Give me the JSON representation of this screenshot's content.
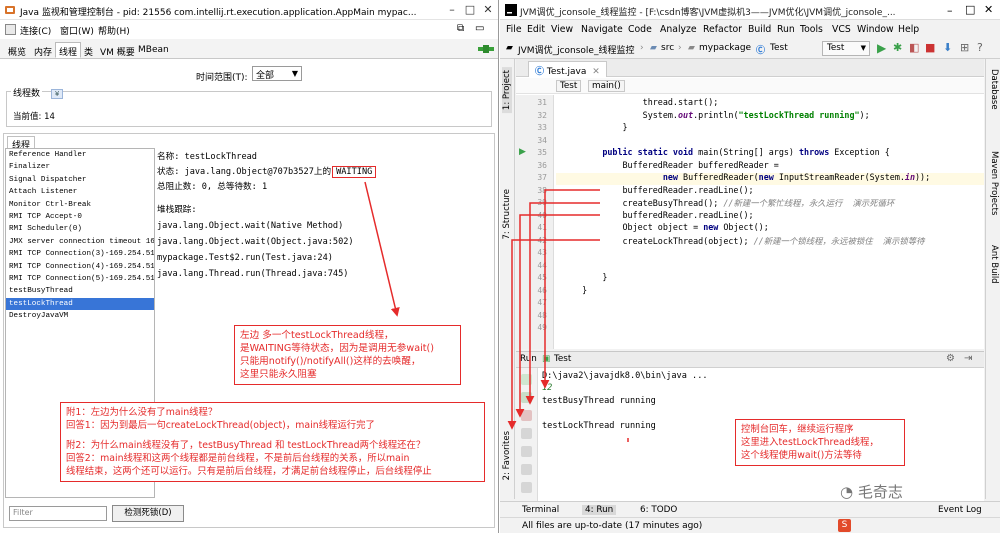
{
  "jconsole": {
    "title": "Java 监视和管理控制台 - pid: 21556 com.intellij.rt.execution.application.AppMain mypac...",
    "menu": [
      "连接(C)",
      "窗口(W)",
      "帮助(H)"
    ],
    "tabs": [
      "概览",
      "内存",
      "线程",
      "类",
      "VM 概要",
      "MBean"
    ],
    "time_range_label": "时间范围(T):",
    "time_range_value": "全部",
    "thread_count_title": "线程数",
    "current_value": "当前值:  14",
    "threads_title": "线程",
    "thread_list": [
      "Reference Handler",
      "Finalizer",
      "Signal Dispatcher",
      "Attach Listener",
      "Monitor Ctrl-Break",
      "RMI TCP Accept-0",
      "RMI Scheduler(0)",
      "JMX server connection timeout 16",
      "RMI TCP Connection(3)-169.254.51.",
      "RMI TCP Connection(4)-169.254.51.",
      "RMI TCP Connection(5)-169.254.51.",
      "testBusyThread",
      "testLockThread",
      "DestroyJavaVM"
    ],
    "selected_thread_index": 12,
    "detail": {
      "name": "名称:  testLockThread",
      "state_prefix": "状态:  java.lang.Object@707b3527上的",
      "state_value": "WAITING",
      "blocked": "总阻止数:  0,  总等待数:  1",
      "stack_title": "堆栈跟踪:",
      "stack": [
        "java.lang.Object.wait(Native Method)",
        "java.lang.Object.wait(Object.java:502)",
        "mypackage.Test$2.run(Test.java:24)",
        "java.lang.Thread.run(Thread.java:745)"
      ]
    },
    "filter_placeholder": "Filter",
    "detect_deadlock": "检测死锁(D)"
  },
  "annotations": {
    "note1": [
      "左边  多一个testLockThread线程，",
      "是WAITING等待状态，因为是调用无参wait()",
      "只能用notify()/notifyAll()这样的去唤醒，",
      "这里只能永久阻塞"
    ],
    "note2": [
      "附1：左边为什么没有了main线程？",
      "回答1：因为到最后一句createLockThread(object)，main线程运行完了",
      "",
      "附2：为什么main线程没有了，testBusyThread 和 testLockThread两个线程还在？",
      "回答2：main线程和这两个线程都是前台线程，不是前后台线程的关系，所以main",
      "线程结束，这两个还可以运行。只有是前后台线程，才满足前台线程停止，后台线程停止"
    ],
    "note3": [
      "控制台回车，继续运行程序",
      "这里进入testLockThread线程，",
      "这个线程使用wait()方法等待"
    ]
  },
  "ide": {
    "title": "JVM调优_jconsole_线程监控 - [F:\\csdn博客\\JVM虚拟机3——JVM优化\\JVM调优_jconsole_...",
    "menu": [
      "File",
      "Edit",
      "View",
      "Navigate",
      "Code",
      "Analyze",
      "Refactor",
      "Build",
      "Run",
      "Tools",
      "VCS",
      "Window",
      "Help"
    ],
    "nav": {
      "project": "JVM调优_jconsole_线程监控",
      "src": "src",
      "pkg": "mypackage",
      "cls": "Test",
      "run_config": "Test"
    },
    "file_tab": "Test.java",
    "crumbs": [
      "Test",
      "main()"
    ],
    "line_numbers": [
      "31",
      "32",
      "33",
      "34",
      "35",
      "36",
      "37",
      "38",
      "39",
      "40",
      "41",
      "42",
      "43",
      "44",
      "45",
      "46",
      "47",
      "48",
      "49"
    ],
    "left_tools": [
      "1: Project",
      "7: Structure",
      "2: Favorites"
    ],
    "right_tools": [
      "Database",
      "Maven Projects",
      "Ant Build"
    ],
    "run": {
      "label": "Run",
      "config": "Test",
      "lines": [
        "D:\\java2\\javajdk8.0\\bin\\java ...",
        "12",
        "testBusyThread running",
        "",
        "testLockThread running"
      ]
    },
    "bottom_tabs": [
      "Terminal",
      "4: Run",
      "6: TODO"
    ],
    "event_log": "Event Log",
    "status": "All files are up-to-date (17 minutes ago)",
    "watermark": "毛奇志"
  },
  "colors": {
    "annotation_red": "#e52b2b",
    "selection_blue": "#3875d7"
  }
}
